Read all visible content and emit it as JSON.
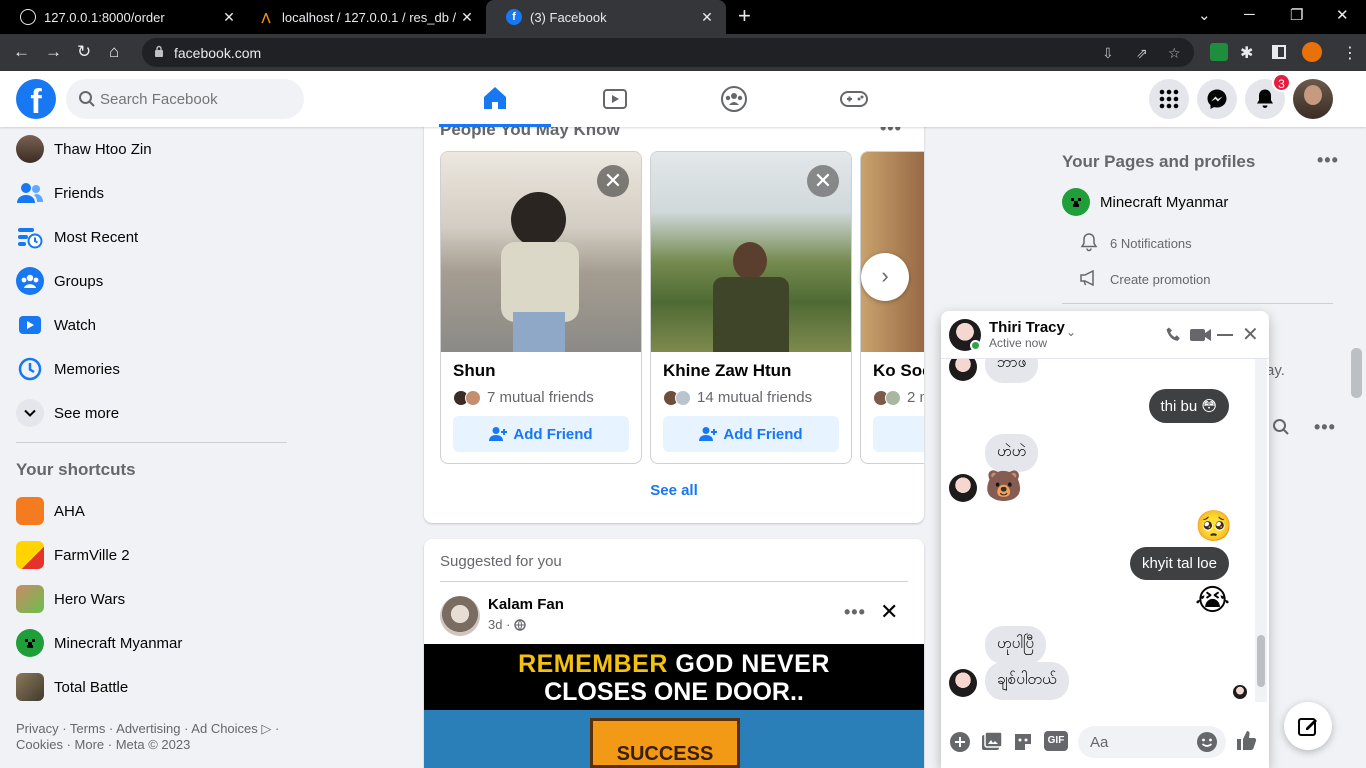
{
  "browser": {
    "tabs": [
      {
        "title": "127.0.0.1:8000/order",
        "icon": "globe-icon"
      },
      {
        "title": "localhost / 127.0.0.1 / res_db / or",
        "icon": "phpmyadmin-icon"
      },
      {
        "title": "(3) Facebook",
        "icon": "facebook-icon"
      }
    ],
    "url": "facebook.com"
  },
  "header": {
    "search_placeholder": "Search Facebook",
    "notification_count": "3",
    "active_tab": "home"
  },
  "sidebar": {
    "items": [
      {
        "label": "Thaw Htoo Zin",
        "icon": "profile-avatar"
      },
      {
        "label": "Friends",
        "icon": "friends-icon"
      },
      {
        "label": "Most Recent",
        "icon": "feed-icon"
      },
      {
        "label": "Groups",
        "icon": "groups-icon"
      },
      {
        "label": "Watch",
        "icon": "watch-icon"
      },
      {
        "label": "Memories",
        "icon": "memories-icon"
      },
      {
        "label": "See more",
        "icon": "chevron-down-icon"
      }
    ],
    "shortcuts_title": "Your shortcuts",
    "shortcuts": [
      {
        "label": "AHA"
      },
      {
        "label": "FarmVille 2"
      },
      {
        "label": "Hero Wars"
      },
      {
        "label": "Minecraft Myanmar"
      },
      {
        "label": "Total Battle"
      }
    ],
    "footer_line1": "Privacy · Terms · Advertising · Ad Choices ▷ ·",
    "footer_line2": "Cookies · More · Meta © 2023"
  },
  "pymk": {
    "title": "People You May Know",
    "people": [
      {
        "name": "Shun",
        "mutual": "7 mutual friends",
        "button": "Add Friend"
      },
      {
        "name": "Khine Zaw Htun",
        "mutual": "14 mutual friends",
        "button": "Add Friend"
      },
      {
        "name": "Ko Soe",
        "mutual": "2 m",
        "button": ""
      }
    ],
    "see_all": "See all"
  },
  "suggested": {
    "title": "Suggested for you",
    "author": "Kalam Fan",
    "time": "3d ·",
    "image_line1a": "REMEMBER",
    "image_line1b": "GOD NEVER",
    "image_line2": "CLOSES ONE DOOR..",
    "image_sign": "SUCCESS"
  },
  "right": {
    "pages_title": "Your Pages and profiles",
    "page_name": "Minecraft Myanmar",
    "notifications": "6 Notifications",
    "promotion": "Create promotion",
    "truncated": "ay."
  },
  "chat": {
    "name": "Thiri Tracy",
    "status": "Active now",
    "input_placeholder": "Aa",
    "messages": [
      {
        "dir": "in",
        "text": "ဘာဖ"
      },
      {
        "dir": "out",
        "text": "thi bu 😳"
      },
      {
        "dir": "in",
        "text": "ဟဲဟဲ"
      },
      {
        "dir": "in_emoji",
        "text": "🐻"
      },
      {
        "dir": "out_emoji",
        "text": "🥺"
      },
      {
        "dir": "out",
        "text": "khyit tal loe"
      },
      {
        "dir": "out_emoji",
        "text": "😭"
      },
      {
        "dir": "in",
        "text": "ဟုပါပြီ"
      },
      {
        "dir": "in",
        "text": "ချစ်ပါတယ်"
      }
    ]
  },
  "colors": {
    "brand": "#1877f2",
    "page_bg": "#f0f2f5",
    "chrome_dark": "#35363a",
    "badge_red": "#e41e3f"
  }
}
